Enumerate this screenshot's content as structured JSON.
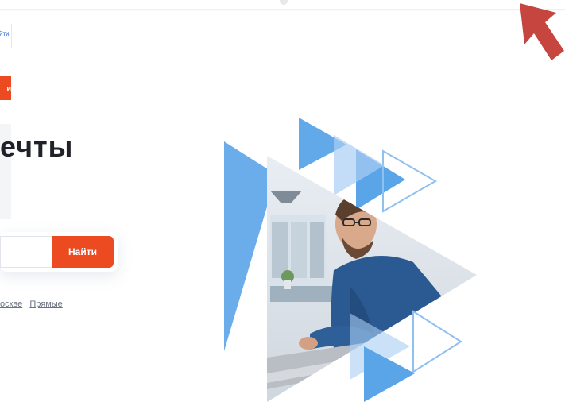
{
  "topbar": {
    "link_text": "йти"
  },
  "badge": {
    "label": "и"
  },
  "hero": {
    "headline": "ечты"
  },
  "search": {
    "placeholder": "",
    "button_label": "Найти"
  },
  "quick_links": [
    {
      "label": "оскве"
    },
    {
      "label": "Прямые"
    }
  ],
  "colors": {
    "accent": "#ec4b22",
    "link_blue": "#2d6bd1",
    "hero_blue": "#5aa4e8",
    "hero_light_blue": "#a9cdf3",
    "cursor_red": "#c7453f"
  },
  "illustration": {
    "name": "person-at-laptop-triangle-collage"
  },
  "overlay": {
    "cursor": "red-pointer-arrow-icon"
  }
}
